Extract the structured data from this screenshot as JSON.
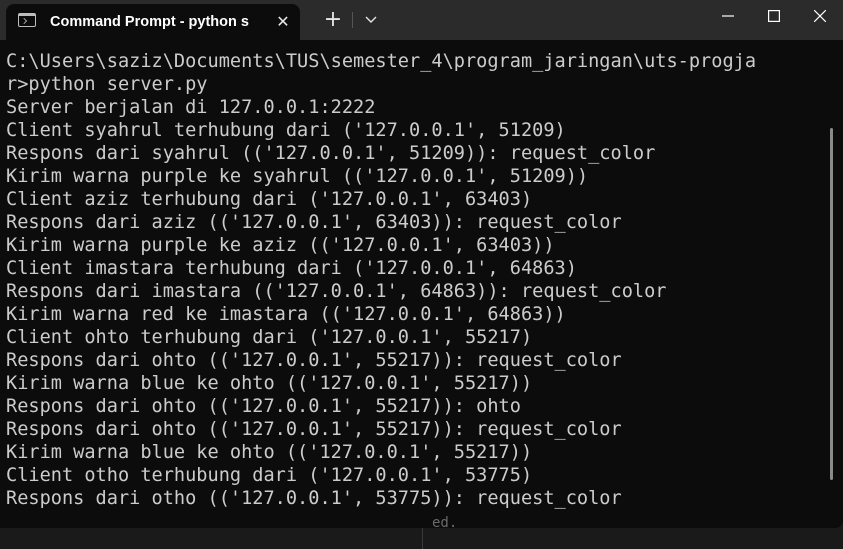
{
  "window": {
    "tab_title": "Command Prompt - python s",
    "tab_icon": "terminal-icon",
    "close_tab_glyph": "✕",
    "new_tab_glyph": "+",
    "controls": [
      "minimize",
      "maximize",
      "close"
    ]
  },
  "terminal": {
    "lines": [
      "C:\\Users\\saziz\\Documents\\TUS\\semester_4\\program_jaringan\\uts-progja",
      "r>python server.py",
      "Server berjalan di 127.0.0.1:2222",
      "Client syahrul terhubung dari ('127.0.0.1', 51209)",
      "Respons dari syahrul (('127.0.0.1', 51209)): request_color",
      "Kirim warna purple ke syahrul (('127.0.0.1', 51209))",
      "Client aziz terhubung dari ('127.0.0.1', 63403)",
      "Respons dari aziz (('127.0.0.1', 63403)): request_color",
      "Kirim warna purple ke aziz (('127.0.0.1', 63403))",
      "Client imastara terhubung dari ('127.0.0.1', 64863)",
      "Respons dari imastara (('127.0.0.1', 64863)): request_color",
      "Kirim warna red ke imastara (('127.0.0.1', 64863))",
      "Client ohto terhubung dari ('127.0.0.1', 55217)",
      "Respons dari ohto (('127.0.0.1', 55217)): request_color",
      "Kirim warna blue ke ohto (('127.0.0.1', 55217))",
      "Respons dari ohto (('127.0.0.1', 55217)): ohto",
      "Respons dari ohto (('127.0.0.1', 55217)): request_color",
      "Kirim warna blue ke ohto (('127.0.0.1', 55217))",
      "Client otho terhubung dari ('127.0.0.1', 53775)",
      "Respons dari otho (('127.0.0.1', 53775)): request_color"
    ]
  },
  "background_window": {
    "partial_text": "ed."
  },
  "colors": {
    "terminal_bg": "#0c0c0c",
    "titlebar_bg": "#2b2b2b",
    "text": "#cccccc"
  }
}
